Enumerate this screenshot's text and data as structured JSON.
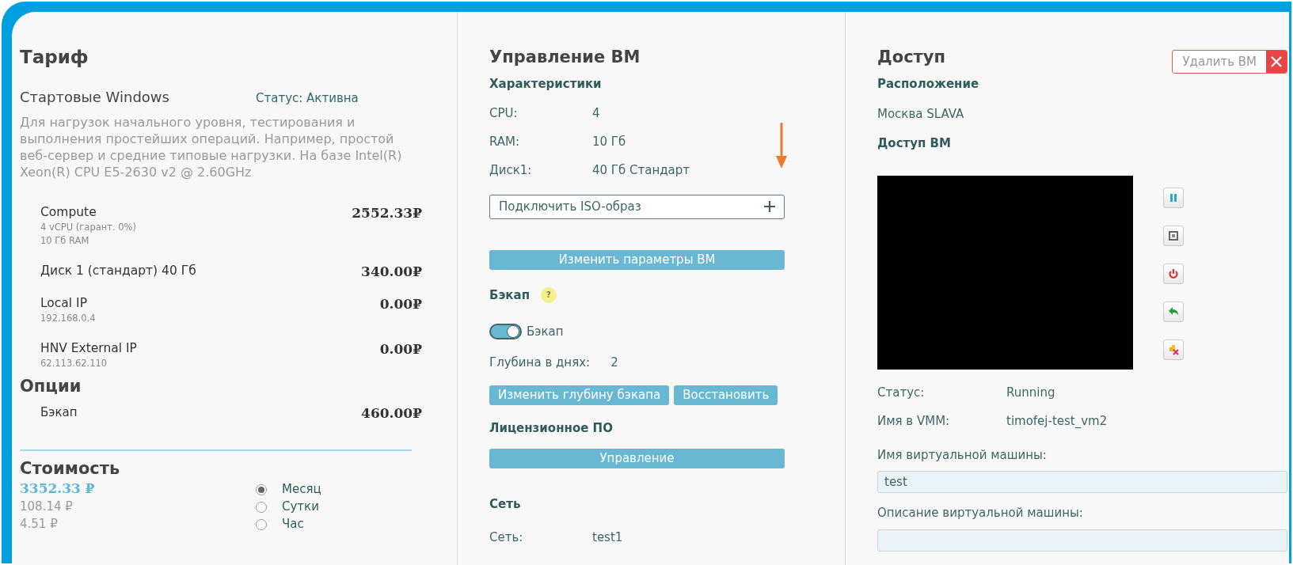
{
  "tariff": {
    "title": "Тариф",
    "plan_name": "Стартовые Windows",
    "status": "Статус: Активна",
    "description": "Для нагрузок начального уровня, тестирования и выполнения простейших операций. Например, простой веб-сервер и средние типовые нагрузки. На базе Intel(R) Xeon(R) CPU E5-2630 v2 @ 2.60GHz",
    "items": [
      {
        "name": "Compute",
        "details": [
          "4 vCPU (гарант. 0%)",
          "10 Гб RAM"
        ],
        "price": "2552.33₽"
      },
      {
        "name": "Диск 1 (стандарт) 40 Гб",
        "price": "340.00₽"
      },
      {
        "name": "Local IP",
        "details": [
          "192.168.0.4"
        ],
        "price": "0.00₽"
      },
      {
        "name": "HNV External IP",
        "details": [
          "62.113.62.110"
        ],
        "price": "0.00₽"
      }
    ],
    "options_title": "Опции",
    "options": [
      {
        "name": "Бэкап",
        "price": "460.00₽"
      }
    ],
    "cost_title": "Стоимость",
    "costs": [
      "3352.33 ₽",
      "108.14 ₽",
      "4.51 ₽"
    ],
    "periods": [
      {
        "label": "Месяц",
        "selected": true
      },
      {
        "label": "Сутки",
        "selected": false
      },
      {
        "label": "Час",
        "selected": false
      }
    ]
  },
  "vm": {
    "title": "Управление ВМ",
    "specs_title": "Характеристики",
    "specs": [
      {
        "label": "CPU:",
        "value": "4"
      },
      {
        "label": "RAM:",
        "value": "10 Гб"
      },
      {
        "label": "Диск1:",
        "value": "40 Гб Стандарт"
      }
    ],
    "iso_button": "Подключить ISO-образ",
    "change_button": "Изменить параметры ВМ",
    "backup_title": "Бэкап",
    "help_icon": "?",
    "backup_toggle": {
      "label": "Бэкап",
      "on": true
    },
    "depth_label": "Глубина в днях:",
    "depth_value": "2",
    "depth_button": "Изменить глубину бэкапа",
    "restore_button": "Восстановить",
    "license_title": "Лицензионное ПО",
    "manage_button": "Управление",
    "network_title": "Сеть",
    "network": [
      {
        "label": "Сеть:",
        "value": "test1"
      }
    ]
  },
  "access": {
    "title": "Доступ",
    "delete_button": "Удалить ВМ",
    "location_title": "Расположение",
    "location": "Москва SLAVA",
    "vm_access_title": "Доступ ВМ",
    "controls": [
      {
        "kind": "pause"
      },
      {
        "kind": "stop"
      },
      {
        "kind": "power"
      },
      {
        "kind": "revert"
      },
      {
        "kind": "remove"
      }
    ],
    "info": [
      {
        "label": "Статус:",
        "value": "Running"
      },
      {
        "label": "Имя в VMM:",
        "value": "timofej-test_vm2"
      }
    ],
    "name_label": "Имя виртуальной машины:",
    "name_value": "test",
    "description_label": "Описание виртуальной машины:"
  }
}
